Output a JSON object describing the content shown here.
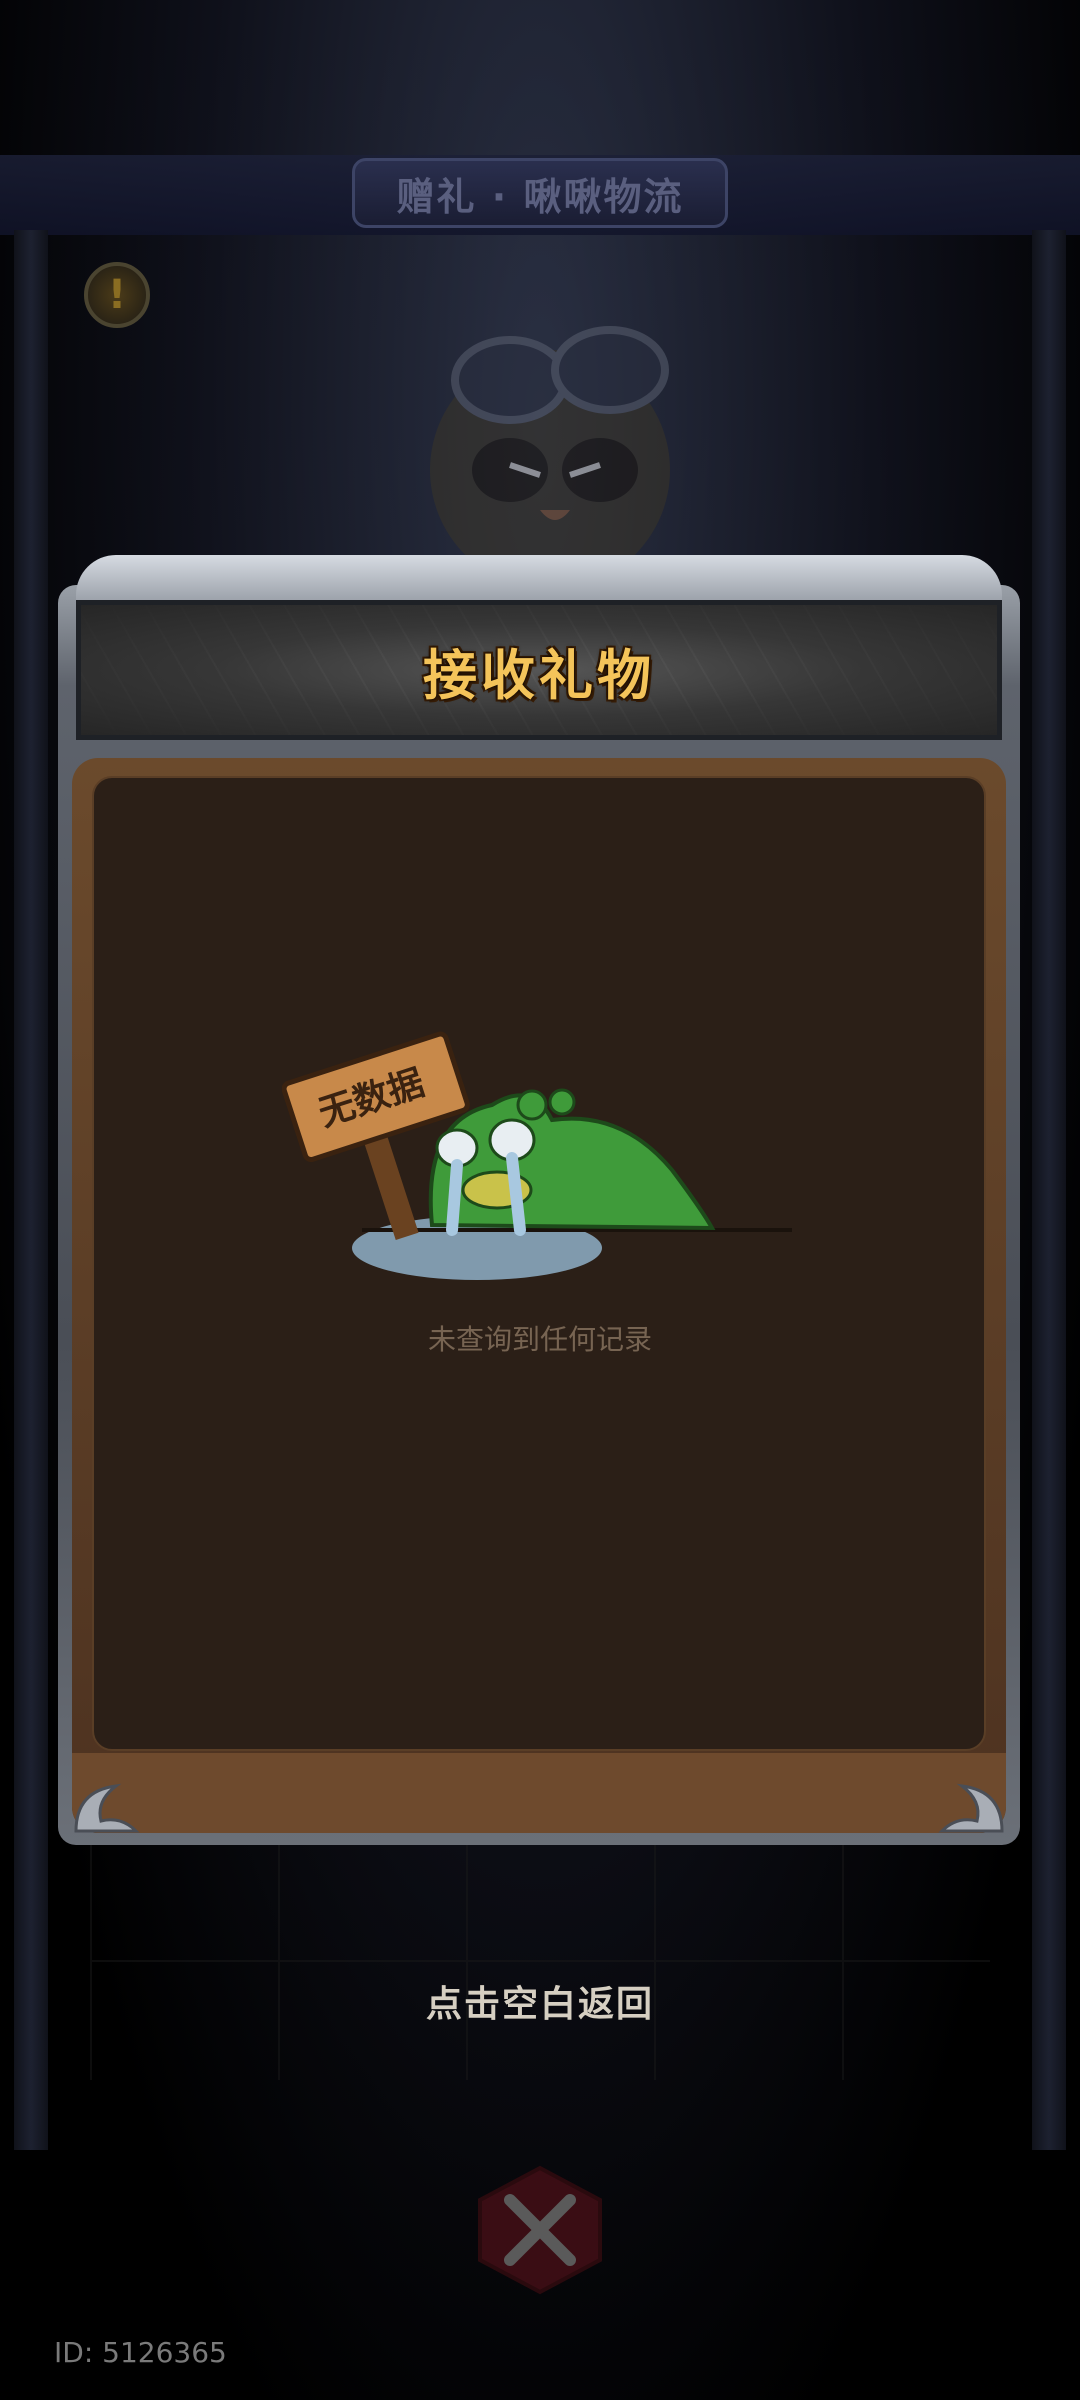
{
  "window": {
    "title": "赠礼 · 啾啾物流"
  },
  "dialog": {
    "title": "接收礼物",
    "empty_sign": "无数据",
    "empty_message": "未查询到任何记录"
  },
  "hint": "点击空白返回",
  "footer": {
    "id_text": "ID: 5126365"
  },
  "colors": {
    "title_gold": "#f4c45a",
    "panel_brown": "#2b1f17",
    "frog_green": "#3f9b3a"
  }
}
